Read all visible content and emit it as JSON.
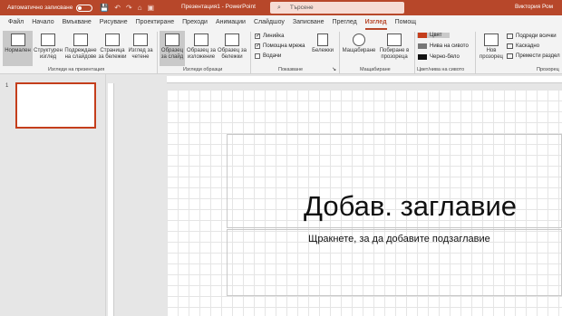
{
  "titlebar": {
    "autosave": "Автоматично записване",
    "title": "Презентация1 - PowerPoint",
    "search": "Търсене",
    "user": "Виктория Ром"
  },
  "qat": [
    "💾",
    "↶",
    "↷",
    "⌂",
    "▣"
  ],
  "tabs": [
    "Файл",
    "Начало",
    "Вмъкване",
    "Рисуване",
    "Проектиране",
    "Преходи",
    "Анимации",
    "Слайдшоу",
    "Записване",
    "Преглед",
    "Изглед",
    "Помощ"
  ],
  "active_tab": "Изглед",
  "ribbon": {
    "normal": "Нормален",
    "outline": "Структурен изглед",
    "sorter": "Подреждане на слайдове",
    "notes_page": "Страница за бележки",
    "reading": "Изглед за четене",
    "group_views": "Изгледи на презентация",
    "slide_master": "Образец за слайд",
    "handout_master": "Образец за изложение",
    "notes_master": "Образец за бележки",
    "group_masters": "Изгледи образци",
    "ruler": "Линийка",
    "gridlines": "Помощна мрежа",
    "guides": "Водачи",
    "notes": "Бележки",
    "group_show": "Показване",
    "zoom": "Мащабиране",
    "fit": "Побиране в прозореца",
    "group_zoom": "Мащабиране",
    "color": "Цвят",
    "grayscale": "Нива на сивото",
    "bw": "Черно-бяло",
    "group_color": "Цвет/нива на сивото",
    "new_window": "Нов прозорец",
    "arrange_all": "Подреди всички",
    "cascade": "Каскадно",
    "move_split": "Премести раздел",
    "group_window": "Прозорец"
  },
  "slide_number": "1",
  "slide": {
    "title": "Добав. заглавие",
    "subtitle": "Щракнете, за да добавите подзаглавие"
  },
  "colors": {
    "accent": "#b7472a"
  }
}
